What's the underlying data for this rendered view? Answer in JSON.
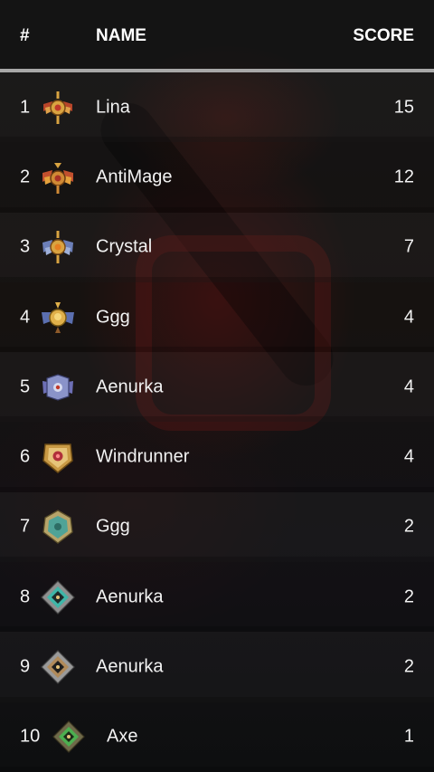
{
  "header": {
    "rank_label": "#",
    "name_label": "NAME",
    "score_label": "SCORE"
  },
  "rows": [
    {
      "rank": "1",
      "name": "Lina",
      "score": "15",
      "medal_icon": "immortal-rank-medal-icon"
    },
    {
      "rank": "2",
      "name": "AntiMage",
      "score": "12",
      "medal_icon": "divine-rank-medal-icon"
    },
    {
      "rank": "3",
      "name": "Crystal",
      "score": "7",
      "medal_icon": "ancient-rank-medal-icon"
    },
    {
      "rank": "4",
      "name": "Ggg",
      "score": "4",
      "medal_icon": "legend-rank-medal-icon"
    },
    {
      "rank": "5",
      "name": "Aenurka",
      "score": "4",
      "medal_icon": "archon-rank-medal-icon"
    },
    {
      "rank": "6",
      "name": "Windrunner",
      "score": "4",
      "medal_icon": "crusader-rank-medal-icon"
    },
    {
      "rank": "7",
      "name": "Ggg",
      "score": "2",
      "medal_icon": "guardian-rank-medal-icon"
    },
    {
      "rank": "8",
      "name": "Aenurka",
      "score": "2",
      "medal_icon": "teal-diamond-medal-icon"
    },
    {
      "rank": "9",
      "name": "Aenurka",
      "score": "2",
      "medal_icon": "bronze-diamond-medal-icon"
    },
    {
      "rank": "10",
      "name": "Axe",
      "score": "1",
      "medal_icon": "herald-rank-medal-icon"
    }
  ],
  "colors": {
    "header_bg": "#121212",
    "rule": "#a8a8a8",
    "text": "#f2f2f2",
    "gold": "#d9a441",
    "red_gem": "#c0392b",
    "teal": "#3fb6a8",
    "green": "#4caf50"
  }
}
